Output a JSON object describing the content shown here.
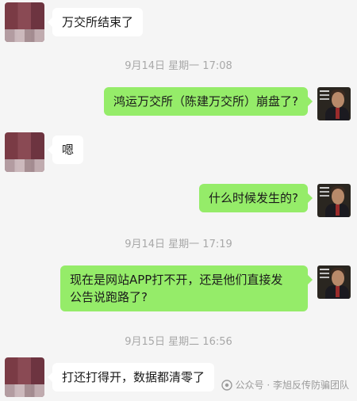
{
  "messages": [
    {
      "side": "left",
      "text": "万交所结束了"
    },
    {
      "side": "right",
      "text": "鸿运万交所（陈建万交所）崩盘了?"
    },
    {
      "side": "left",
      "text": "嗯"
    },
    {
      "side": "right",
      "text": "什么时候发生的?"
    },
    {
      "side": "right",
      "text_line1": "现在是网站APP打不开，还是他们直接发",
      "text_line2": "公告说跑路了?"
    },
    {
      "side": "left",
      "text": "打还打得开，数据都清零了"
    }
  ],
  "timestamps": [
    "9月14日 星期一 17:08",
    "9月14日 星期一 17:19",
    "9月15日 星期二 16:56"
  ],
  "watermark": {
    "text": "公众号 · 李旭反传防骗团队",
    "icon": "wechat-official-account-icon"
  },
  "colors": {
    "bg": "#f5f5f5",
    "sent_bubble": "#95ec69",
    "received_bubble": "#ffffff",
    "timestamp": "#a8a8a8"
  }
}
